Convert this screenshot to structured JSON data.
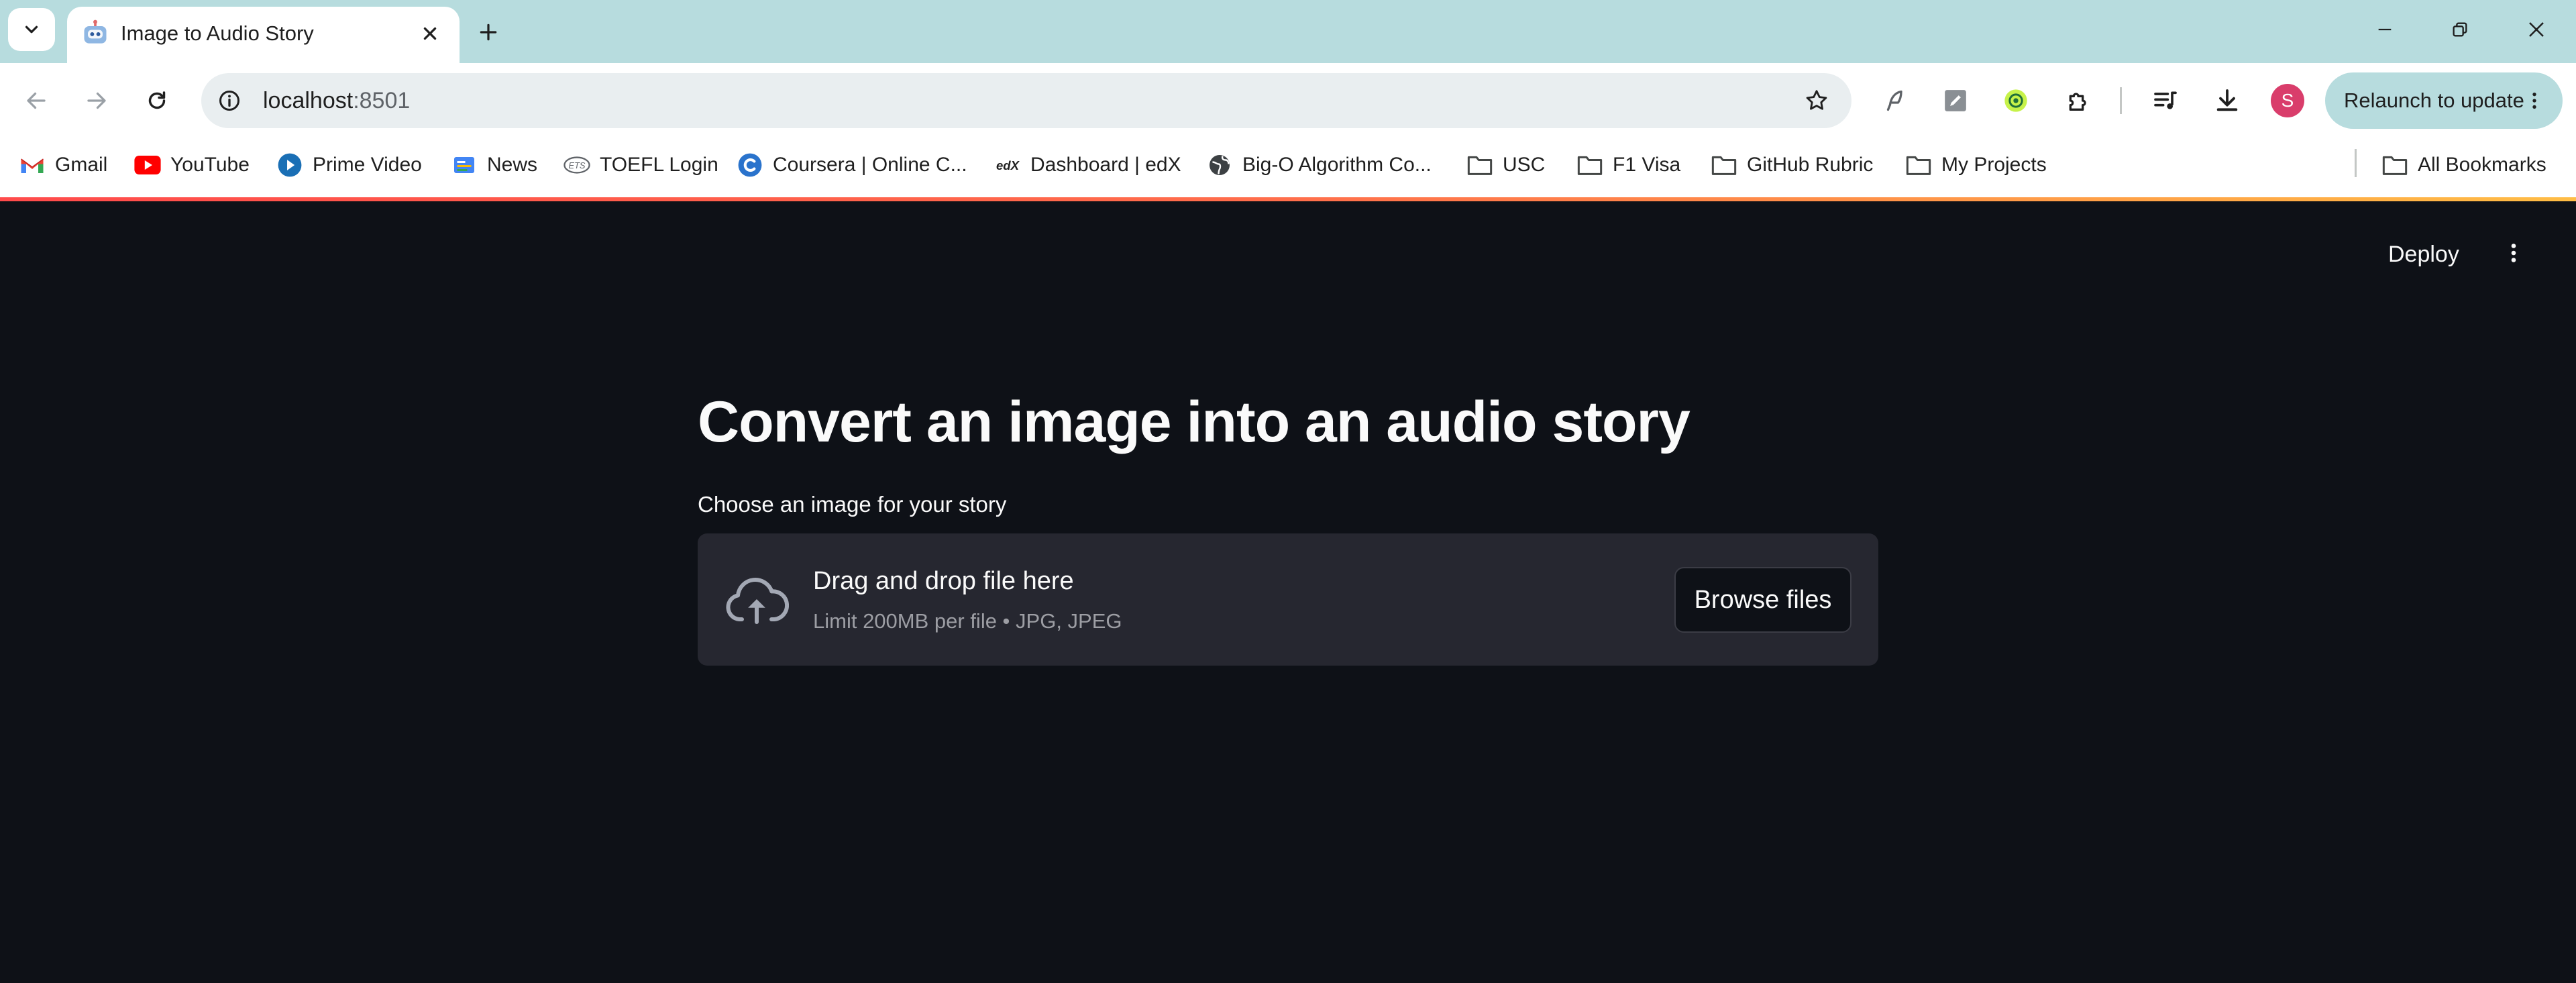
{
  "browser": {
    "tab": {
      "title": "Image to Audio Story"
    },
    "address_bar": {
      "host": "localhost",
      "port": ":8501"
    },
    "profile_initial": "S",
    "relaunch_label": "Relaunch to update",
    "bookmarks": [
      {
        "label": "Gmail",
        "icon": "gmail-icon"
      },
      {
        "label": "YouTube",
        "icon": "youtube-icon"
      },
      {
        "label": "Prime Video",
        "icon": "prime-video-icon"
      },
      {
        "label": "News",
        "icon": "news-icon"
      },
      {
        "label": "TOEFL Login",
        "icon": "ets-icon"
      },
      {
        "label": "Coursera | Online C...",
        "icon": "coursera-icon"
      },
      {
        "label": "Dashboard | edX",
        "icon": "edx-icon"
      },
      {
        "label": "Big-O Algorithm Co...",
        "icon": "globe-icon"
      },
      {
        "label": "USC",
        "icon": "folder-icon"
      },
      {
        "label": "F1 Visa",
        "icon": "folder-icon"
      },
      {
        "label": "GitHub Rubric",
        "icon": "folder-icon"
      },
      {
        "label": "My Projects",
        "icon": "folder-icon"
      }
    ],
    "all_bookmarks": "All Bookmarks"
  },
  "app": {
    "deploy_label": "Deploy",
    "heading": "Convert an image into an audio story",
    "uploader": {
      "label": "Choose an image for your story",
      "drop_title": "Drag and drop file here",
      "drop_subtitle": "Limit 200MB per file • JPG, JPEG",
      "browse_label": "Browse files"
    }
  },
  "colors": {
    "app_background": "#0e1117",
    "dropzone_background": "#262730",
    "tabstrip": "#b7dcde",
    "text_primary": "#fafafa",
    "text_muted": "#9d9ea4",
    "avatar": "#d93d6b"
  }
}
